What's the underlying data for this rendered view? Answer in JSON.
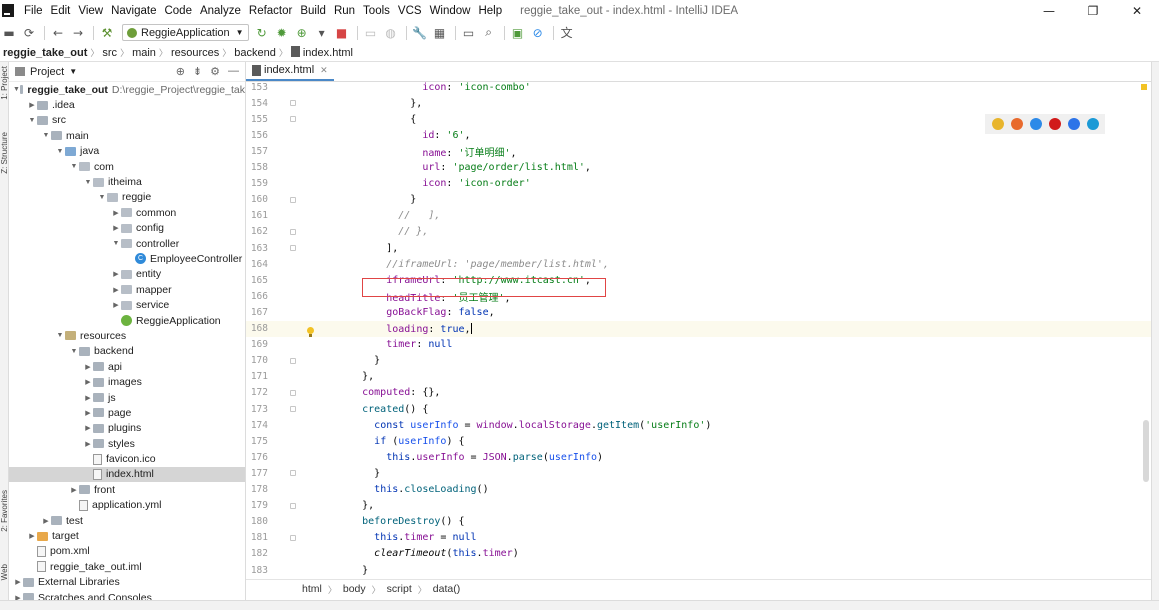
{
  "menubar": {
    "items": [
      "File",
      "Edit",
      "View",
      "Navigate",
      "Code",
      "Analyze",
      "Refactor",
      "Build",
      "Run",
      "Tools",
      "VCS",
      "Window",
      "Help"
    ],
    "window_title": "reggie_take_out - index.html - IntelliJ IDEA",
    "controls": [
      "—",
      "❐",
      "✕"
    ]
  },
  "toolbar": {
    "run_config": "ReggieApplication"
  },
  "navbar": {
    "crumbs": [
      "reggie_take_out",
      "src",
      "main",
      "resources",
      "backend",
      "index.html"
    ]
  },
  "left_stripe": {
    "labels": [
      "1: Project",
      "Z: Structure",
      "2: Favorites",
      "Web"
    ]
  },
  "project_panel": {
    "title": "Project",
    "tree": [
      {
        "label": "reggie_take_out",
        "path": "D:\\reggie_Project\\reggie_tak",
        "depth": 0,
        "expanded": true,
        "kind": "module"
      },
      {
        "label": ".idea",
        "depth": 1,
        "expanded": false,
        "kind": "folder"
      },
      {
        "label": "src",
        "depth": 1,
        "expanded": true,
        "kind": "folder"
      },
      {
        "label": "main",
        "depth": 2,
        "expanded": true,
        "kind": "folder"
      },
      {
        "label": "java",
        "depth": 3,
        "expanded": true,
        "kind": "src"
      },
      {
        "label": "com",
        "depth": 4,
        "expanded": true,
        "kind": "pkg"
      },
      {
        "label": "itheima",
        "depth": 5,
        "expanded": true,
        "kind": "pkg"
      },
      {
        "label": "reggie",
        "depth": 6,
        "expanded": true,
        "kind": "pkg"
      },
      {
        "label": "common",
        "depth": 7,
        "expanded": false,
        "kind": "pkg"
      },
      {
        "label": "config",
        "depth": 7,
        "expanded": false,
        "kind": "pkg"
      },
      {
        "label": "controller",
        "depth": 7,
        "expanded": true,
        "kind": "pkg"
      },
      {
        "label": "EmployeeController",
        "depth": 8,
        "kind": "class"
      },
      {
        "label": "entity",
        "depth": 7,
        "expanded": false,
        "kind": "pkg"
      },
      {
        "label": "mapper",
        "depth": 7,
        "expanded": false,
        "kind": "pkg"
      },
      {
        "label": "service",
        "depth": 7,
        "expanded": false,
        "kind": "pkg"
      },
      {
        "label": "ReggieApplication",
        "depth": 7,
        "kind": "spring"
      },
      {
        "label": "resources",
        "depth": 3,
        "expanded": true,
        "kind": "res"
      },
      {
        "label": "backend",
        "depth": 4,
        "expanded": true,
        "kind": "folder"
      },
      {
        "label": "api",
        "depth": 5,
        "expanded": false,
        "kind": "folder"
      },
      {
        "label": "images",
        "depth": 5,
        "expanded": false,
        "kind": "folder"
      },
      {
        "label": "js",
        "depth": 5,
        "expanded": false,
        "kind": "folder"
      },
      {
        "label": "page",
        "depth": 5,
        "expanded": false,
        "kind": "folder"
      },
      {
        "label": "plugins",
        "depth": 5,
        "expanded": false,
        "kind": "folder"
      },
      {
        "label": "styles",
        "depth": 5,
        "expanded": false,
        "kind": "folder"
      },
      {
        "label": "favicon.ico",
        "depth": 5,
        "kind": "file"
      },
      {
        "label": "index.html",
        "depth": 5,
        "kind": "file",
        "selected": true
      },
      {
        "label": "front",
        "depth": 4,
        "expanded": false,
        "kind": "folder"
      },
      {
        "label": "application.yml",
        "depth": 4,
        "kind": "file"
      },
      {
        "label": "test",
        "depth": 2,
        "expanded": false,
        "kind": "folder"
      },
      {
        "label": "target",
        "depth": 1,
        "expanded": false,
        "kind": "target"
      },
      {
        "label": "pom.xml",
        "depth": 1,
        "kind": "file"
      },
      {
        "label": "reggie_take_out.iml",
        "depth": 1,
        "kind": "file"
      },
      {
        "label": "External Libraries",
        "depth": 0,
        "expanded": false,
        "kind": "folder"
      },
      {
        "label": "Scratches and Consoles",
        "depth": 0,
        "expanded": false,
        "kind": "folder"
      }
    ]
  },
  "editor": {
    "tab_label": "index.html",
    "current_line": 168,
    "lines": [
      {
        "n": 153,
        "tokens": [
          [
            "plain",
            "                "
          ],
          [
            "key",
            "icon"
          ],
          [
            "plain",
            ": "
          ],
          [
            "str",
            "'icon-combo'"
          ]
        ]
      },
      {
        "n": 154,
        "tokens": [
          [
            "plain",
            "              },"
          ]
        ]
      },
      {
        "n": 155,
        "tokens": [
          [
            "plain",
            "              {"
          ]
        ]
      },
      {
        "n": 156,
        "tokens": [
          [
            "plain",
            "                "
          ],
          [
            "key",
            "id"
          ],
          [
            "plain",
            ": "
          ],
          [
            "str",
            "'6'"
          ],
          [
            "plain",
            ","
          ]
        ]
      },
      {
        "n": 157,
        "tokens": [
          [
            "plain",
            "                "
          ],
          [
            "key",
            "name"
          ],
          [
            "plain",
            ": "
          ],
          [
            "str",
            "'订单明细'"
          ],
          [
            "plain",
            ","
          ]
        ]
      },
      {
        "n": 158,
        "tokens": [
          [
            "plain",
            "                "
          ],
          [
            "key",
            "url"
          ],
          [
            "plain",
            ": "
          ],
          [
            "str",
            "'page/order/list.html'"
          ],
          [
            "plain",
            ","
          ]
        ]
      },
      {
        "n": 159,
        "tokens": [
          [
            "plain",
            "                "
          ],
          [
            "key",
            "icon"
          ],
          [
            "plain",
            ": "
          ],
          [
            "str",
            "'icon-order'"
          ]
        ]
      },
      {
        "n": 160,
        "tokens": [
          [
            "plain",
            "              }"
          ]
        ]
      },
      {
        "n": 161,
        "tokens": [
          [
            "plain",
            "            "
          ],
          [
            "cmt",
            "//   ],"
          ]
        ]
      },
      {
        "n": 162,
        "tokens": [
          [
            "plain",
            "            "
          ],
          [
            "cmt",
            "// },"
          ]
        ]
      },
      {
        "n": 163,
        "tokens": [
          [
            "plain",
            "          ],"
          ]
        ]
      },
      {
        "n": 164,
        "tokens": [
          [
            "plain",
            "          "
          ],
          [
            "cmt",
            "//iframeUrl: 'page/member/list.html',"
          ]
        ]
      },
      {
        "n": 165,
        "tokens": [
          [
            "plain",
            "          "
          ],
          [
            "key",
            "iframeUrl"
          ],
          [
            "plain",
            ": "
          ],
          [
            "str",
            "'http://www.itcast.cn'"
          ],
          [
            "plain",
            ","
          ]
        ]
      },
      {
        "n": 166,
        "tokens": [
          [
            "plain",
            "          "
          ],
          [
            "key",
            "headTitle"
          ],
          [
            "plain",
            ": "
          ],
          [
            "str",
            "'员工管理'"
          ],
          [
            "plain",
            ","
          ]
        ]
      },
      {
        "n": 167,
        "tokens": [
          [
            "plain",
            "          "
          ],
          [
            "key",
            "goBackFlag"
          ],
          [
            "plain",
            ": "
          ],
          [
            "kw",
            "false"
          ],
          [
            "plain",
            ","
          ]
        ]
      },
      {
        "n": 168,
        "tokens": [
          [
            "plain",
            "          "
          ],
          [
            "key",
            "loading"
          ],
          [
            "plain",
            ": "
          ],
          [
            "kw",
            "true"
          ],
          [
            "plain",
            ","
          ]
        ]
      },
      {
        "n": 169,
        "tokens": [
          [
            "plain",
            "          "
          ],
          [
            "key",
            "timer"
          ],
          [
            "plain",
            ": "
          ],
          [
            "kw",
            "null"
          ]
        ]
      },
      {
        "n": 170,
        "tokens": [
          [
            "plain",
            "        }"
          ]
        ]
      },
      {
        "n": 171,
        "tokens": [
          [
            "plain",
            "      },"
          ]
        ]
      },
      {
        "n": 172,
        "tokens": [
          [
            "plain",
            "      "
          ],
          [
            "key",
            "computed"
          ],
          [
            "plain",
            ": {},"
          ]
        ]
      },
      {
        "n": 173,
        "tokens": [
          [
            "plain",
            "      "
          ],
          [
            "fn",
            "created"
          ],
          [
            "plain",
            "() {"
          ]
        ]
      },
      {
        "n": 174,
        "tokens": [
          [
            "plain",
            "        "
          ],
          [
            "kw",
            "const "
          ],
          [
            "var",
            "userInfo"
          ],
          [
            "plain",
            " = "
          ],
          [
            "key",
            "window"
          ],
          [
            "plain",
            "."
          ],
          [
            "key",
            "localStorage"
          ],
          [
            "plain",
            "."
          ],
          [
            "fn",
            "getItem"
          ],
          [
            "plain",
            "("
          ],
          [
            "str",
            "'userInfo'"
          ],
          [
            "plain",
            ")"
          ]
        ]
      },
      {
        "n": 175,
        "tokens": [
          [
            "plain",
            "        "
          ],
          [
            "kw",
            "if "
          ],
          [
            "plain",
            "("
          ],
          [
            "var",
            "userInfo"
          ],
          [
            "plain",
            ") {"
          ]
        ]
      },
      {
        "n": 176,
        "tokens": [
          [
            "plain",
            "          "
          ],
          [
            "kw",
            "this"
          ],
          [
            "plain",
            "."
          ],
          [
            "key",
            "userInfo"
          ],
          [
            "plain",
            " = "
          ],
          [
            "key",
            "JSON"
          ],
          [
            "plain",
            "."
          ],
          [
            "fn",
            "parse"
          ],
          [
            "plain",
            "("
          ],
          [
            "var",
            "userInfo"
          ],
          [
            "plain",
            ")"
          ]
        ]
      },
      {
        "n": 177,
        "tokens": [
          [
            "plain",
            "        }"
          ]
        ]
      },
      {
        "n": 178,
        "tokens": [
          [
            "plain",
            "        "
          ],
          [
            "kw",
            "this"
          ],
          [
            "plain",
            "."
          ],
          [
            "fn",
            "closeLoading"
          ],
          [
            "plain",
            "()"
          ]
        ]
      },
      {
        "n": 179,
        "tokens": [
          [
            "plain",
            "      },"
          ]
        ]
      },
      {
        "n": 180,
        "tokens": [
          [
            "plain",
            "      "
          ],
          [
            "fn",
            "beforeDestroy"
          ],
          [
            "plain",
            "() {"
          ]
        ]
      },
      {
        "n": 181,
        "tokens": [
          [
            "plain",
            "        "
          ],
          [
            "kw",
            "this"
          ],
          [
            "plain",
            "."
          ],
          [
            "key",
            "timer"
          ],
          [
            "plain",
            " = "
          ],
          [
            "kw",
            "null"
          ]
        ]
      },
      {
        "n": 182,
        "tokens": [
          [
            "plain",
            "        "
          ],
          [
            "itl",
            "clearTimeout"
          ],
          [
            "plain",
            "("
          ],
          [
            "kw",
            "this"
          ],
          [
            "plain",
            "."
          ],
          [
            "key",
            "timer"
          ],
          [
            "plain",
            ")"
          ]
        ]
      },
      {
        "n": 183,
        "tokens": [
          [
            "plain",
            "      }"
          ]
        ]
      }
    ]
  },
  "editor_breadcrumb": [
    "html",
    "body",
    "script",
    "data()"
  ],
  "browser_icons": [
    {
      "name": "chrome-icon",
      "color": "#e8b52d"
    },
    {
      "name": "firefox-icon",
      "color": "#e86a2d"
    },
    {
      "name": "safari-icon",
      "color": "#2d8ae8"
    },
    {
      "name": "opera-icon",
      "color": "#d11a1a"
    },
    {
      "name": "ie-icon",
      "color": "#2d74e8"
    },
    {
      "name": "edge-icon",
      "color": "#1b9ad6"
    }
  ],
  "colors": {
    "highlight_box": "#e04545",
    "selected_row": "#d5d5d5",
    "current_line": "#fcfaed",
    "tab_underline": "#4a88c7"
  }
}
